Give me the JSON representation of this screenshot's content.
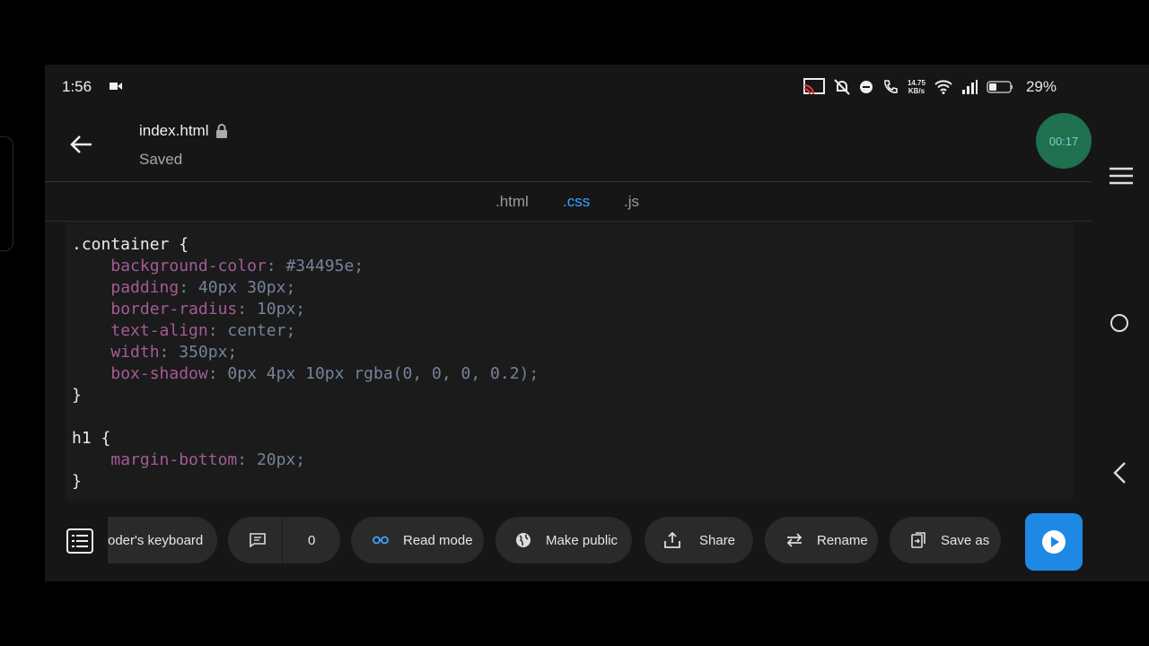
{
  "status_bar": {
    "time": "1:56",
    "net_speed_value": "14.75",
    "net_speed_unit": "KB/s",
    "battery": "29%"
  },
  "header": {
    "filename": "index.html",
    "save_status": "Saved",
    "timer": "00:17"
  },
  "tabs": [
    ".html",
    ".css",
    ".js"
  ],
  "active_tab": ".css",
  "code": {
    "l1_sel": ".container {",
    "l2_prop": "background-color",
    "l2_val": "#34495e;",
    "l3_prop": "padding",
    "l3_val": "40px 30px;",
    "l4_prop": "border-radius",
    "l4_val": "10px;",
    "l5_prop": "text-align",
    "l5_val": "center;",
    "l6_prop": "width",
    "l6_val": "350px;",
    "l7_prop": "box-shadow",
    "l7_val": "0px 4px 10px rgba(0, 0, 0, 0.2);",
    "l8_close": "}",
    "l10_sel": "h1 {",
    "l11_prop": "margin-bottom",
    "l11_val": "20px;",
    "l12_close": "}"
  },
  "bottom_bar": {
    "keyboard_label": "oder's keyboard",
    "comments_count": "0",
    "read_mode": "Read mode",
    "make_public": "Make public",
    "share": "Share",
    "rename": "Rename",
    "save_as": "Save as"
  },
  "colors": {
    "accent": "#3da3ff",
    "run_button": "#1e88e5",
    "timer_bg": "#1f7a56",
    "css_property": "#a45b97",
    "css_value": "#74849a"
  }
}
